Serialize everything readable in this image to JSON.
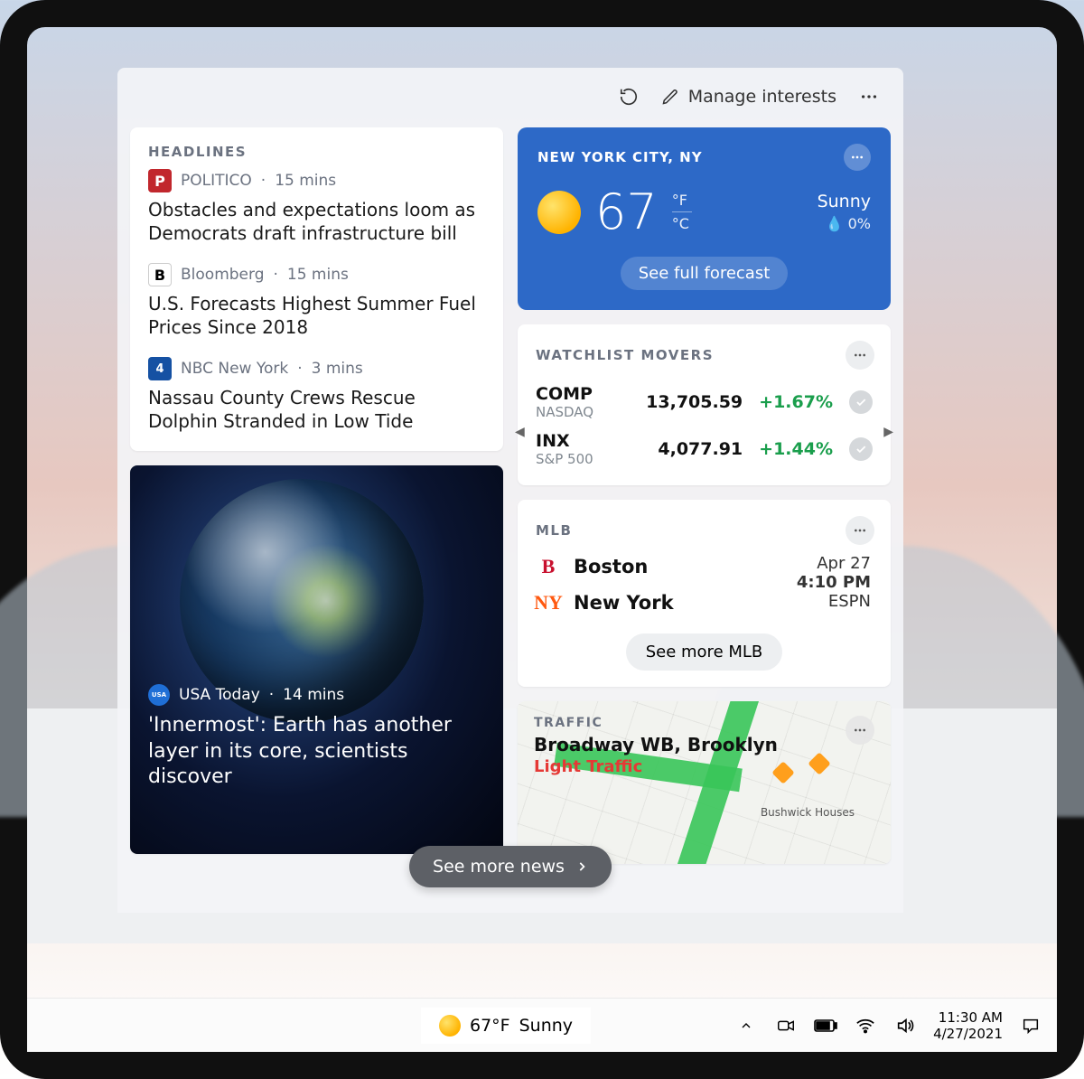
{
  "toolbar": {
    "manage_interests": "Manage interests"
  },
  "headlines": {
    "header": "HEADLINES",
    "items": [
      {
        "source": "POLITICO",
        "badge": "P",
        "badge_color": "#c1272d",
        "time": "15 mins",
        "title": "Obstacles and expectations loom as Democrats draft infrastructure bill"
      },
      {
        "source": "Bloomberg",
        "badge": "B",
        "badge_color": "#000000",
        "time": "15 mins",
        "title": "U.S. Forecasts Highest Summer Fuel Prices Since 2018"
      },
      {
        "source": "NBC New York",
        "badge": "4",
        "badge_color": "#1551a3",
        "time": "3 mins",
        "title": "Nassau County Crews Rescue Dolphin Stranded in Low Tide"
      }
    ],
    "feature": {
      "source": "USA Today",
      "time": "14 mins",
      "title": "'Innermost': Earth has another layer in its core, scientists discover"
    }
  },
  "weather": {
    "location": "NEW YORK CITY, NY",
    "temp": "67",
    "unit_f": "°F",
    "unit_c": "°C",
    "condition": "Sunny",
    "precip": "0%",
    "forecast_btn": "See full forecast"
  },
  "stocks": {
    "header": "WATCHLIST MOVERS",
    "rows": [
      {
        "symbol": "COMP",
        "sub": "NASDAQ",
        "price": "13,705.59",
        "change": "+1.67%"
      },
      {
        "symbol": "INX",
        "sub": "S&P 500",
        "price": "4,077.91",
        "change": "+1.44%"
      }
    ]
  },
  "mlb": {
    "header": "MLB",
    "team1": "Boston",
    "team2": "New York",
    "date": "Apr 27",
    "time": "4:10 PM",
    "network": "ESPN",
    "see_more": "See more MLB"
  },
  "traffic": {
    "header": "TRAFFIC",
    "location": "Broadway WB, Brooklyn",
    "status": "Light Traffic",
    "labels": {
      "bushwick": "Bushwick Houses"
    }
  },
  "see_more_news": "See more news",
  "taskbar": {
    "temp": "67°F",
    "cond": "Sunny",
    "time": "11:30 AM",
    "date": "4/27/2021"
  }
}
